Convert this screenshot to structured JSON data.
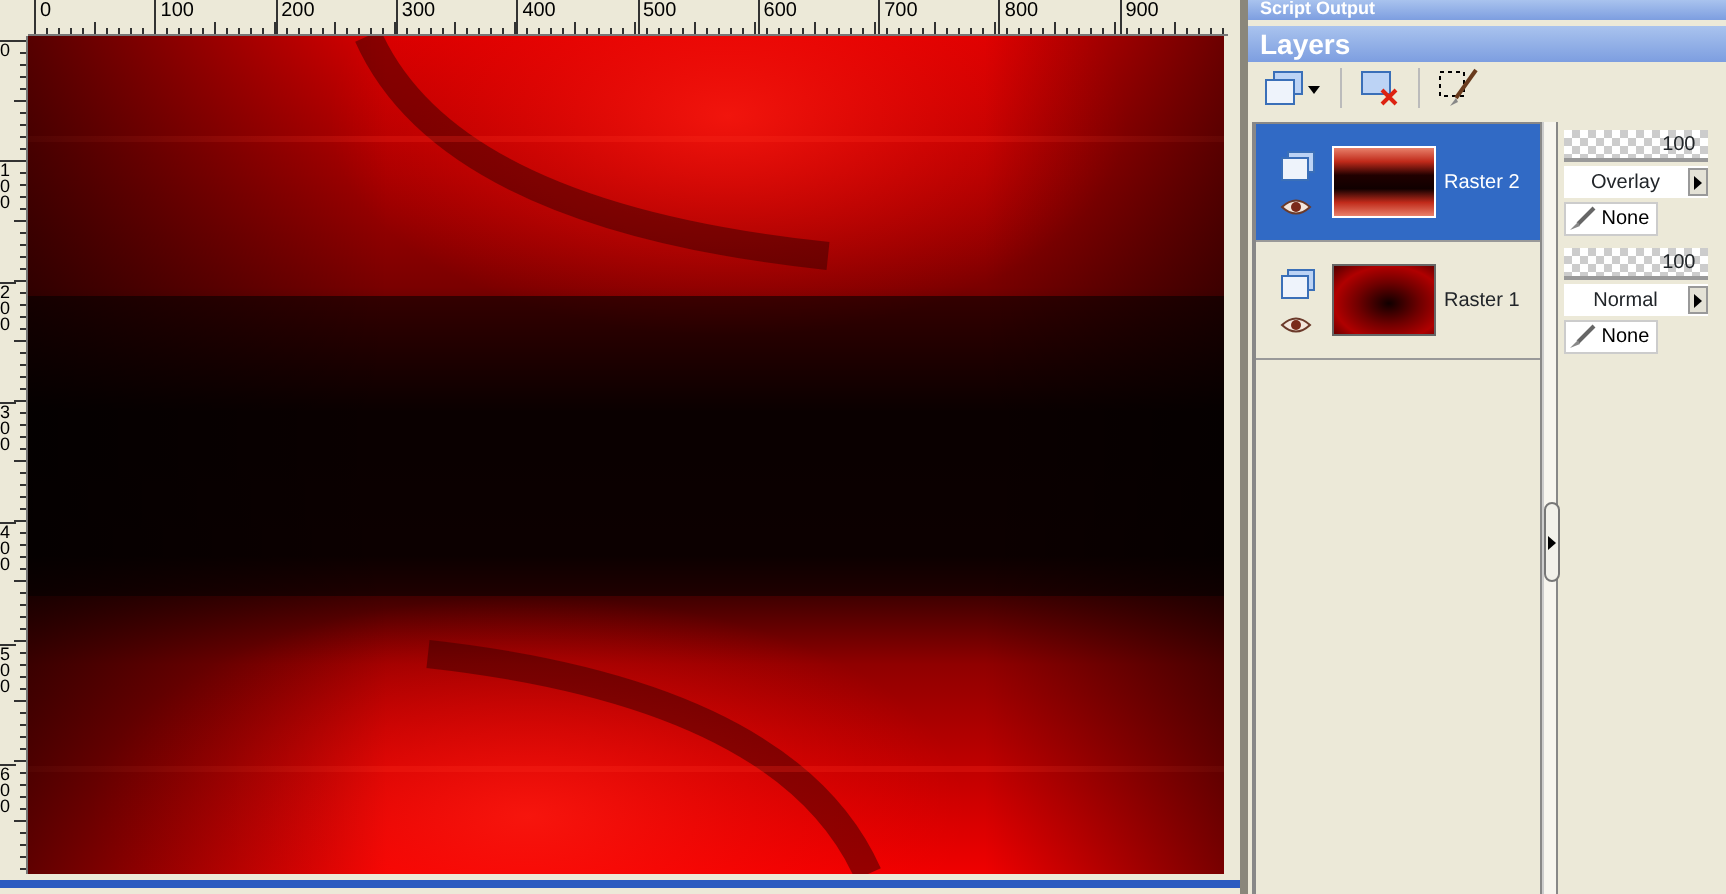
{
  "rulers": {
    "horizontal": [
      "0",
      "100",
      "200",
      "300",
      "400",
      "500",
      "600",
      "700",
      "800",
      "900"
    ],
    "vertical": [
      "0",
      "100",
      "200",
      "300",
      "400",
      "500",
      "600"
    ]
  },
  "script_output": {
    "title": "Script Output"
  },
  "layers_panel": {
    "title": "Layers",
    "layers": [
      {
        "name": "Raster 2",
        "selected": true,
        "visible": true,
        "opacity": "100",
        "level": 1,
        "blend_mode": "Overlay",
        "mask": "None",
        "kind": "bands"
      },
      {
        "name": "Raster 1",
        "selected": false,
        "visible": true,
        "opacity": "100",
        "level": 1,
        "blend_mode": "Normal",
        "mask": "None",
        "kind": "rays"
      }
    ]
  }
}
